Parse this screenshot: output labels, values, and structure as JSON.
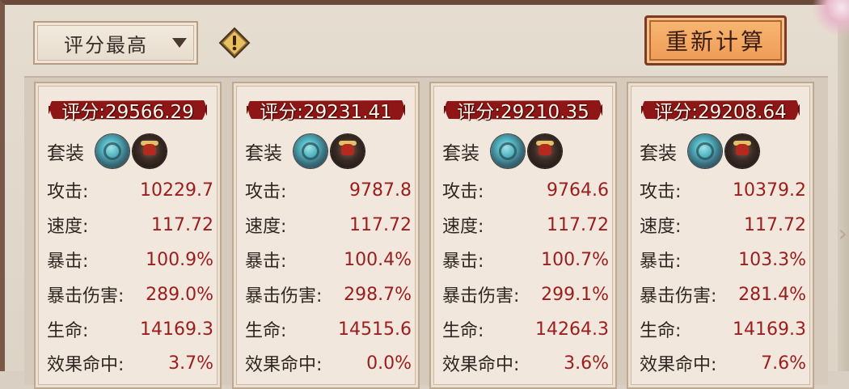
{
  "sort": {
    "selected": "评分最高"
  },
  "recalc_button": "重新计算",
  "colors": {
    "value_red": "#9a1e1e",
    "banner_red": "#8f1616",
    "button_orange": "#ef9a55"
  },
  "cards": [
    {
      "score": "评分:29566.29",
      "set_label": "套装",
      "souls": [
        "teal-soul-icon",
        "dark-soul-icon"
      ],
      "stats": [
        {
          "label": "攻击:",
          "value": "10229.7"
        },
        {
          "label": "速度:",
          "value": "117.72"
        },
        {
          "label": "暴击:",
          "value": "100.9%"
        },
        {
          "label": "暴击伤害:",
          "value": "289.0%"
        },
        {
          "label": "生命:",
          "value": "14169.3"
        },
        {
          "label": "效果命中:",
          "value": "3.7%"
        }
      ]
    },
    {
      "score": "评分:29231.41",
      "set_label": "套装",
      "souls": [
        "teal-soul-icon",
        "dark-soul-icon"
      ],
      "stats": [
        {
          "label": "攻击:",
          "value": "9787.8"
        },
        {
          "label": "速度:",
          "value": "117.72"
        },
        {
          "label": "暴击:",
          "value": "100.4%"
        },
        {
          "label": "暴击伤害:",
          "value": "298.7%"
        },
        {
          "label": "生命:",
          "value": "14515.6"
        },
        {
          "label": "效果命中:",
          "value": "0.0%"
        }
      ]
    },
    {
      "score": "评分:29210.35",
      "set_label": "套装",
      "souls": [
        "teal-soul-icon",
        "dark-soul-icon"
      ],
      "stats": [
        {
          "label": "攻击:",
          "value": "9764.6"
        },
        {
          "label": "速度:",
          "value": "117.72"
        },
        {
          "label": "暴击:",
          "value": "100.7%"
        },
        {
          "label": "暴击伤害:",
          "value": "299.1%"
        },
        {
          "label": "生命:",
          "value": "14264.3"
        },
        {
          "label": "效果命中:",
          "value": "3.6%"
        }
      ]
    },
    {
      "score": "评分:29208.64",
      "set_label": "套装",
      "souls": [
        "teal-soul-icon",
        "dark-soul-icon"
      ],
      "stats": [
        {
          "label": "攻击:",
          "value": "10379.2"
        },
        {
          "label": "速度:",
          "value": "117.72"
        },
        {
          "label": "暴击:",
          "value": "103.3%"
        },
        {
          "label": "暴击伤害:",
          "value": "281.4%"
        },
        {
          "label": "生命:",
          "value": "14169.3"
        },
        {
          "label": "效果命中:",
          "value": "7.6%"
        }
      ]
    }
  ]
}
